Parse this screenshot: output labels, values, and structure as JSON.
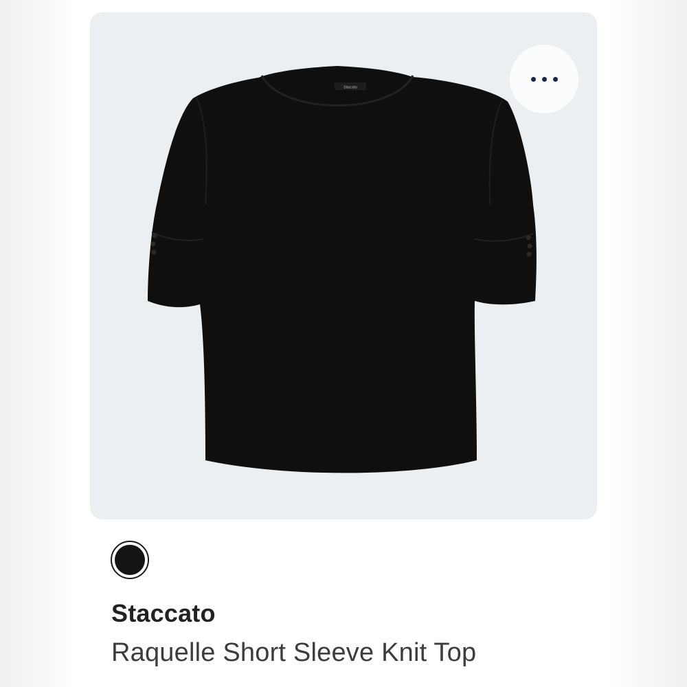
{
  "product": {
    "brand": "Staccato",
    "name": "Raquelle Short Sleeve Knit Top",
    "image_label": "black short sleeve knit top",
    "garment_tag_text": "Staccato",
    "selected_color": "#141414"
  },
  "actions": {
    "more_icon": "more-horizontal-icon"
  },
  "colors": {
    "card_background": "#ebeff1",
    "more_dots": "#17284f"
  }
}
